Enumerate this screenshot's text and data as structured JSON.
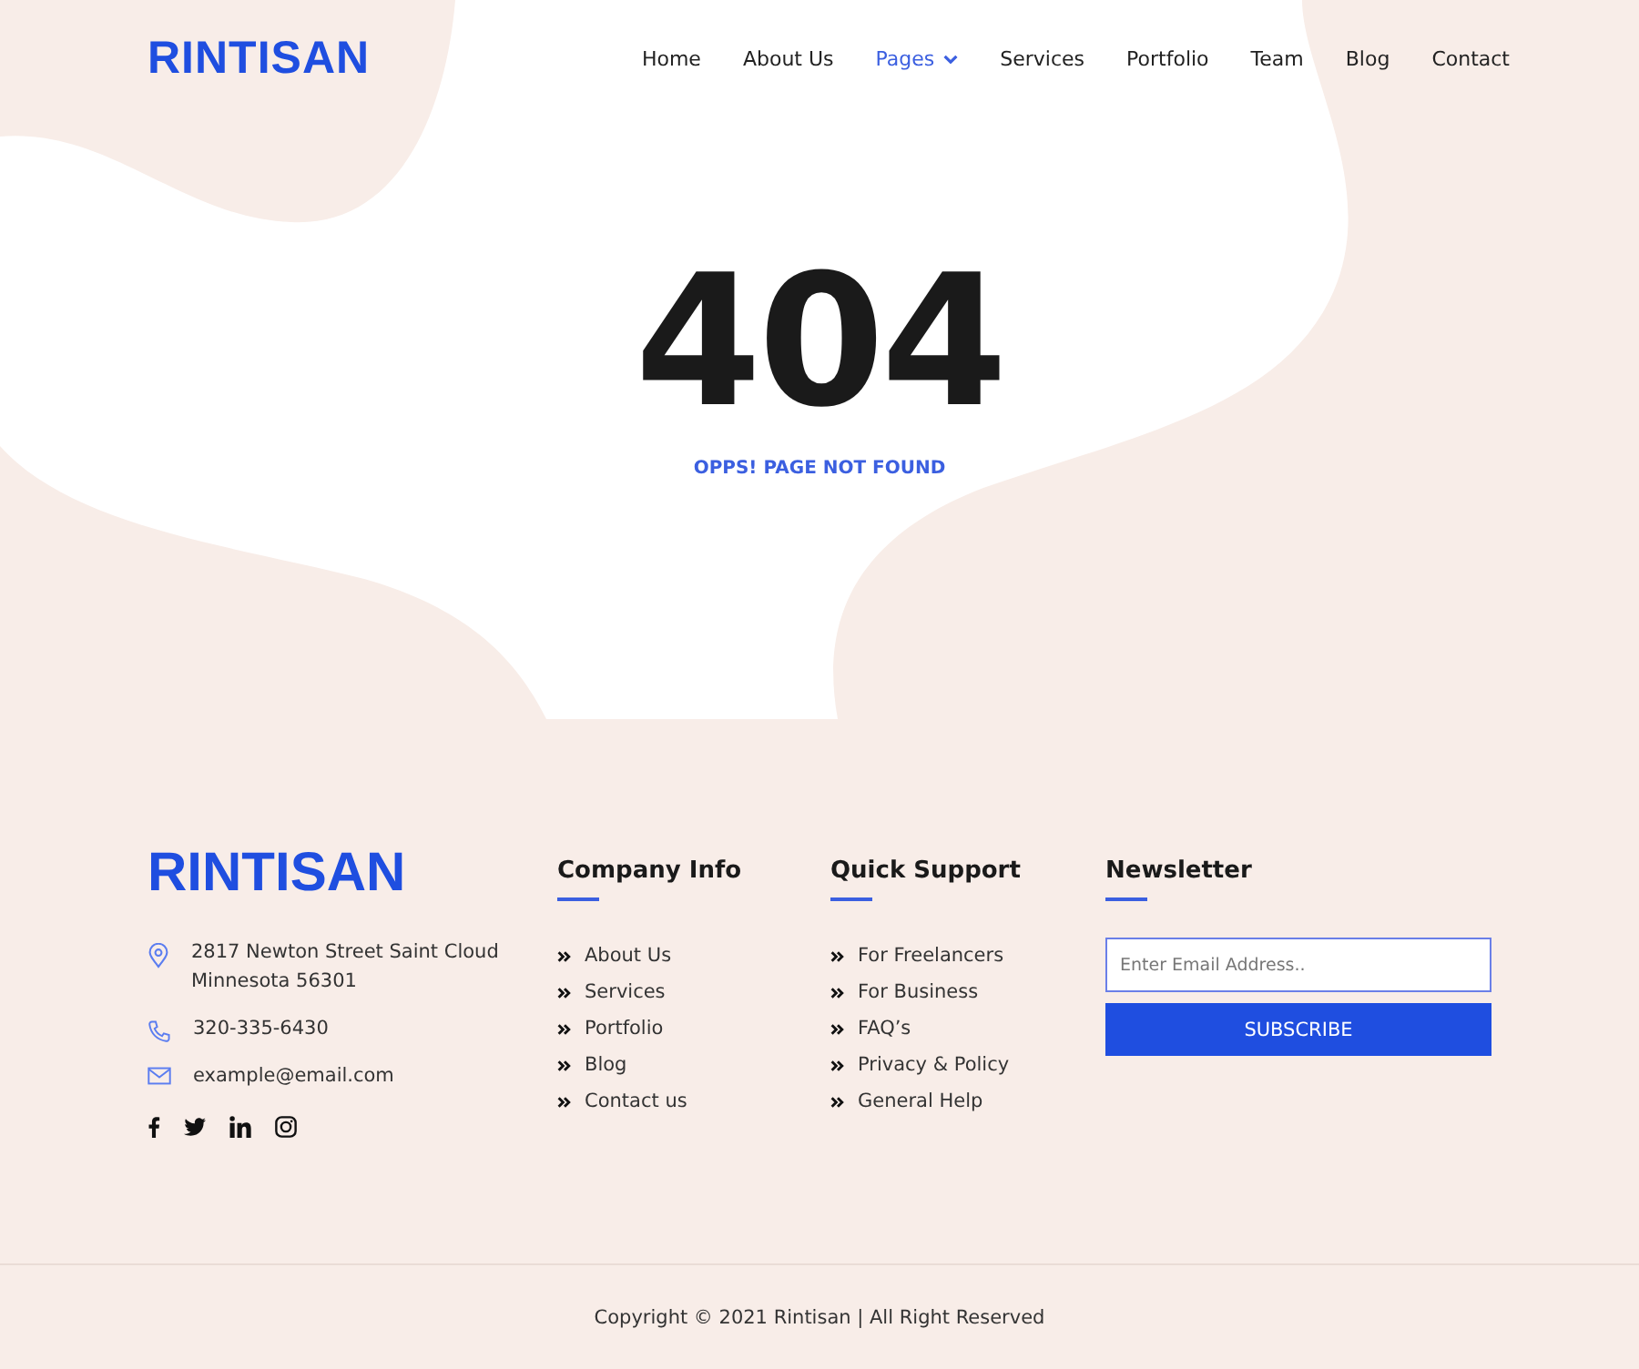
{
  "header": {
    "logo": "RINTISAN",
    "nav": [
      {
        "label": "Home",
        "selected": false,
        "dropdown": false
      },
      {
        "label": "About Us",
        "selected": false,
        "dropdown": false
      },
      {
        "label": "Pages",
        "selected": true,
        "dropdown": true
      },
      {
        "label": "Services",
        "selected": false,
        "dropdown": false
      },
      {
        "label": "Portfolio",
        "selected": false,
        "dropdown": false
      },
      {
        "label": "Team",
        "selected": false,
        "dropdown": false
      },
      {
        "label": "Blog",
        "selected": false,
        "dropdown": false
      },
      {
        "label": "Contact",
        "selected": false,
        "dropdown": false
      }
    ]
  },
  "error": {
    "code": "404",
    "message": "OPPS! PAGE NOT FOUND"
  },
  "footer": {
    "logo": "RINTISAN",
    "contacts": [
      {
        "kind": "address",
        "lines": [
          "2817 Newton Street Saint Cloud",
          "Minnesota 56301"
        ]
      },
      {
        "kind": "phone",
        "lines": [
          "320-335-6430"
        ]
      },
      {
        "kind": "email",
        "lines": [
          "example@email.com"
        ]
      }
    ],
    "social": [
      {
        "kind": "facebook"
      },
      {
        "kind": "twitter"
      },
      {
        "kind": "linkedin"
      },
      {
        "kind": "instagram"
      }
    ],
    "columns": [
      {
        "title": "Company Info",
        "links": [
          "About Us",
          "Services",
          "Portfolio",
          "Blog",
          "Contact us"
        ]
      },
      {
        "title": "Quick Support",
        "links": [
          "For Freelancers",
          "For Business",
          "FAQ’s",
          "Privacy & Policy",
          "General Help"
        ]
      }
    ],
    "newsletter": {
      "title": "Newsletter",
      "placeholder": "Enter Email Address..",
      "button": "SUBSCRIBE"
    },
    "copyright": "Copyright © 2021 Rintisan | All Right Reserved"
  }
}
